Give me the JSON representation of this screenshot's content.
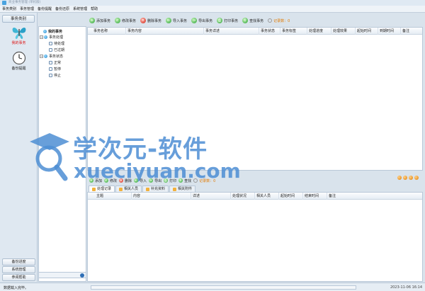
{
  "window": {
    "title": "商业事务管理 (单机版)"
  },
  "menu": [
    "事务类别",
    "事务管理",
    "备份提醒",
    "备份还原",
    "系统管理",
    "帮助"
  ],
  "left_nav": {
    "header": "事务类别",
    "tiles": [
      {
        "label": "我的事务",
        "icon": "butterfly-icon",
        "active": true
      },
      {
        "label": "备份提醒",
        "icon": "clock-icon",
        "active": false
      }
    ],
    "bottom_buttons": [
      "备份进度",
      "系统管理",
      "参阅帮助"
    ]
  },
  "tree": {
    "root": "我的事务",
    "groups": [
      {
        "label": "事务处理",
        "children": [
          "待处理",
          "已过期"
        ]
      },
      {
        "label": "事务状态",
        "children": [
          "正常",
          "暂停",
          "停止"
        ]
      }
    ]
  },
  "toolbar": {
    "buttons": [
      "添加事务",
      "修改事务",
      "删除事务",
      "导入事务",
      "导出事务",
      "打印事务",
      "查找事务"
    ],
    "record_count": "记录数：0"
  },
  "main_grid": {
    "columns": [
      "事务名称",
      "事务内容",
      "事务详述",
      "事务状态",
      "事务标签",
      "处理进度",
      "处理效果",
      "起始时间",
      "到期时间",
      "备注"
    ]
  },
  "watermark": {
    "cn": "学次元-软件",
    "en": "xueciyuan.com"
  },
  "sub_toolbar": {
    "buttons": [
      "添加",
      "修改",
      "删除",
      "导入",
      "导出",
      "打印",
      "查找"
    ],
    "record_count": "记录数：0"
  },
  "sub_tabs": [
    "处理记录",
    "相关人员",
    "补充资料",
    "相关附件"
  ],
  "sub_grid": {
    "columns": [
      "主题",
      "内容",
      "详述",
      "处理状况",
      "相关人员",
      "起始时间",
      "结束时间",
      "备注"
    ]
  },
  "status": {
    "message": "数据载入完毕。",
    "clock": "2023-11-06 16:14"
  },
  "colors": {
    "accent": "#2ea13a",
    "danger": "#d0281b",
    "count": "#e27a00",
    "watermark": "#4d8ed4"
  }
}
